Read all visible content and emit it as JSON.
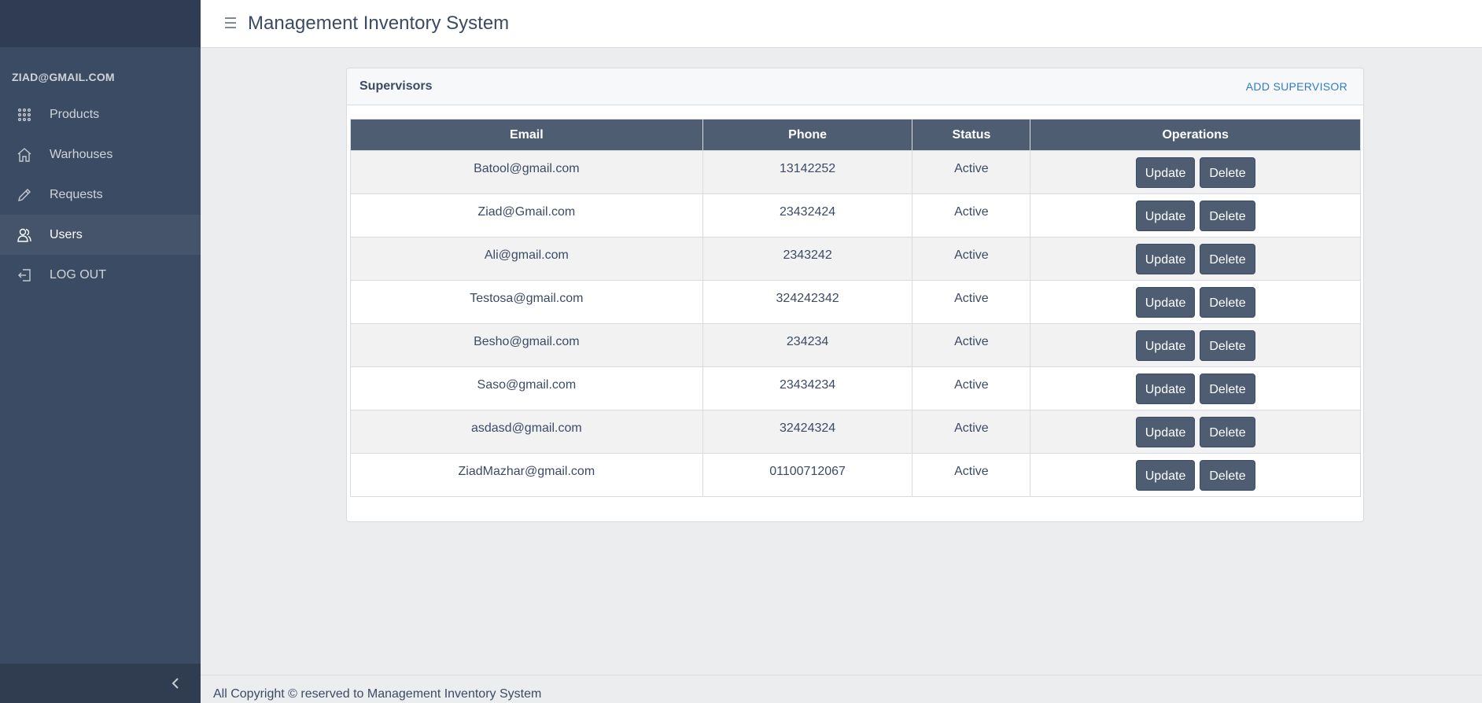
{
  "sidebar": {
    "user_email": "ZIAD@GMAIL.COM",
    "items": [
      {
        "label": "Products",
        "icon": "grid-icon"
      },
      {
        "label": "Warhouses",
        "icon": "home-icon"
      },
      {
        "label": "Requests",
        "icon": "pencil-icon"
      },
      {
        "label": "Users",
        "icon": "users-icon",
        "active": true
      },
      {
        "label": "LOG OUT",
        "icon": "logout-icon"
      }
    ]
  },
  "header": {
    "title": "Management Inventory System"
  },
  "card": {
    "title": "Supervisors",
    "action_label": "ADD SUPERVISOR"
  },
  "table": {
    "columns": [
      "Email",
      "Phone",
      "Status",
      "Operations"
    ],
    "update_label": "Update",
    "delete_label": "Delete",
    "rows": [
      {
        "email": "Batool@gmail.com",
        "phone": "13142252",
        "status": "Active"
      },
      {
        "email": "Ziad@Gmail.com",
        "phone": "23432424",
        "status": "Active"
      },
      {
        "email": "Ali@gmail.com",
        "phone": "2343242",
        "status": "Active"
      },
      {
        "email": "Testosa@gmail.com",
        "phone": "324242342",
        "status": "Active"
      },
      {
        "email": "Besho@gmail.com",
        "phone": "234234",
        "status": "Active"
      },
      {
        "email": "Saso@gmail.com",
        "phone": "23434234",
        "status": "Active"
      },
      {
        "email": "asdasd@gmail.com",
        "phone": "32424324",
        "status": "Active"
      },
      {
        "email": "ZiadMazhar@gmail.com",
        "phone": "01100712067",
        "status": "Active"
      }
    ]
  },
  "footer": {
    "text": "All Copyright © reserved to Management Inventory System"
  },
  "colors": {
    "sidebar_bg": "#3c4b64",
    "table_header_bg": "#4f5d73",
    "link_accent": "#2f7bcc"
  }
}
